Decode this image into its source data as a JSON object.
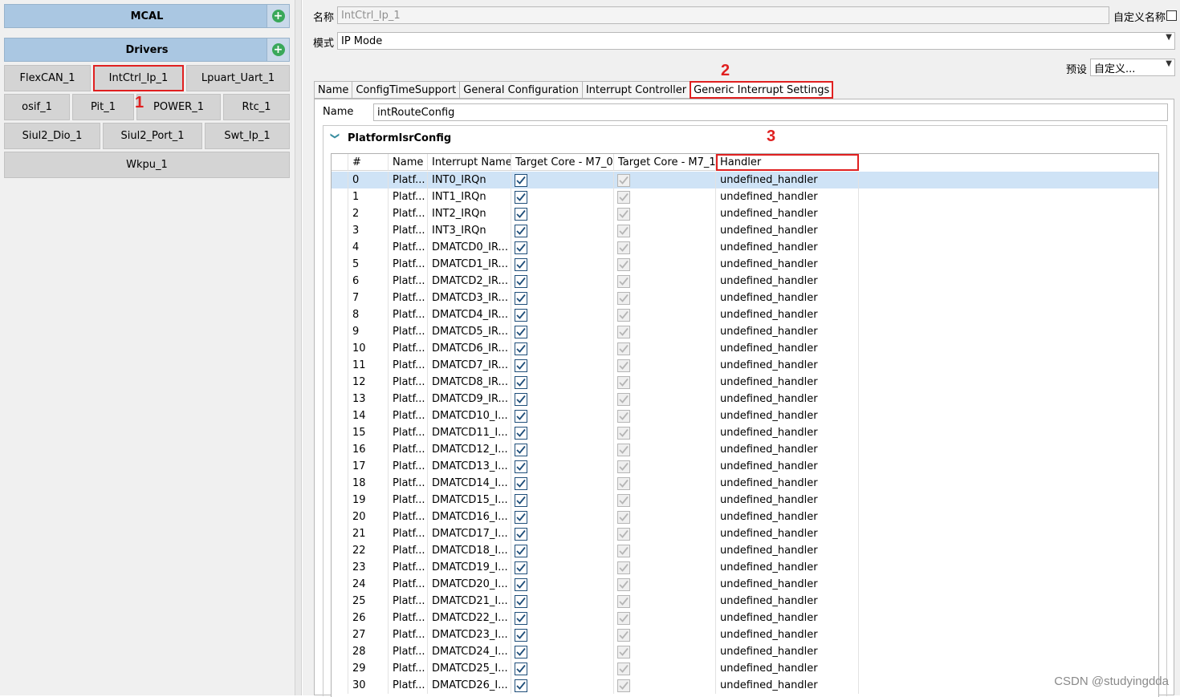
{
  "left_panel": {
    "mcal_header": "MCAL",
    "drivers_header": "Drivers",
    "plus_glyph": "+",
    "drivers": [
      "FlexCAN_1",
      "IntCtrl_Ip_1",
      "Lpuart_Uart_1",
      "osif_1",
      "Pit_1",
      "POWER_1",
      "Rtc_1",
      "Siul2_Dio_1",
      "Siul2_Port_1",
      "Swt_Ip_1",
      "Wkpu_1"
    ]
  },
  "annotations": {
    "mark1": "1",
    "mark2": "2",
    "mark3": "3",
    "color": "#e02020"
  },
  "form": {
    "name_label": "名称",
    "name_value": "IntCtrl_Ip_1",
    "custom_name_label": "自定义名称",
    "mode_label": "模式",
    "mode_value": "IP Mode",
    "preset_label": "预设",
    "preset_value": "自定义..."
  },
  "tabs": [
    "Name",
    "ConfigTimeSupport",
    "General Configuration",
    "Interrupt Controller",
    "Generic Interrupt Settings"
  ],
  "active_tab": "Generic Interrupt Settings",
  "panel": {
    "name_label": "Name",
    "name_value": "intRouteConfig",
    "group_title": "PlatformIsrConfig",
    "expand_glyph": "❯"
  },
  "table": {
    "columns": [
      "#",
      "Name",
      "Interrupt Name",
      "Target Core - M7_0",
      "Target Core - M7_1",
      "Handler"
    ],
    "rows": [
      [
        "0",
        "Platf...",
        "INT0_IRQn",
        "undefined_handler"
      ],
      [
        "1",
        "Platf...",
        "INT1_IRQn",
        "undefined_handler"
      ],
      [
        "2",
        "Platf...",
        "INT2_IRQn",
        "undefined_handler"
      ],
      [
        "3",
        "Platf...",
        "INT3_IRQn",
        "undefined_handler"
      ],
      [
        "4",
        "Platf...",
        "DMATCD0_IR...",
        "undefined_handler"
      ],
      [
        "5",
        "Platf...",
        "DMATCD1_IR...",
        "undefined_handler"
      ],
      [
        "6",
        "Platf...",
        "DMATCD2_IR...",
        "undefined_handler"
      ],
      [
        "7",
        "Platf...",
        "DMATCD3_IR...",
        "undefined_handler"
      ],
      [
        "8",
        "Platf...",
        "DMATCD4_IR...",
        "undefined_handler"
      ],
      [
        "9",
        "Platf...",
        "DMATCD5_IR...",
        "undefined_handler"
      ],
      [
        "10",
        "Platf...",
        "DMATCD6_IR...",
        "undefined_handler"
      ],
      [
        "11",
        "Platf...",
        "DMATCD7_IR...",
        "undefined_handler"
      ],
      [
        "12",
        "Platf...",
        "DMATCD8_IR...",
        "undefined_handler"
      ],
      [
        "13",
        "Platf...",
        "DMATCD9_IR...",
        "undefined_handler"
      ],
      [
        "14",
        "Platf...",
        "DMATCD10_I...",
        "undefined_handler"
      ],
      [
        "15",
        "Platf...",
        "DMATCD11_I...",
        "undefined_handler"
      ],
      [
        "16",
        "Platf...",
        "DMATCD12_I...",
        "undefined_handler"
      ],
      [
        "17",
        "Platf...",
        "DMATCD13_I...",
        "undefined_handler"
      ],
      [
        "18",
        "Platf...",
        "DMATCD14_I...",
        "undefined_handler"
      ],
      [
        "19",
        "Platf...",
        "DMATCD15_I...",
        "undefined_handler"
      ],
      [
        "20",
        "Platf...",
        "DMATCD16_I...",
        "undefined_handler"
      ],
      [
        "21",
        "Platf...",
        "DMATCD17_I...",
        "undefined_handler"
      ],
      [
        "22",
        "Platf...",
        "DMATCD18_I...",
        "undefined_handler"
      ],
      [
        "23",
        "Platf...",
        "DMATCD19_I...",
        "undefined_handler"
      ],
      [
        "24",
        "Platf...",
        "DMATCD20_I...",
        "undefined_handler"
      ],
      [
        "25",
        "Platf...",
        "DMATCD21_I...",
        "undefined_handler"
      ],
      [
        "26",
        "Platf...",
        "DMATCD22_I...",
        "undefined_handler"
      ],
      [
        "27",
        "Platf...",
        "DMATCD23_I...",
        "undefined_handler"
      ],
      [
        "28",
        "Platf...",
        "DMATCD24_I...",
        "undefined_handler"
      ],
      [
        "29",
        "Platf...",
        "DMATCD25_I...",
        "undefined_handler"
      ],
      [
        "30",
        "Platf...",
        "DMATCD26_I...",
        "undefined_handler"
      ]
    ],
    "selected_row": 0,
    "m7_0_checked": true,
    "m7_1_checked_disabled": true
  },
  "watermark": "CSDN @studyingdda"
}
